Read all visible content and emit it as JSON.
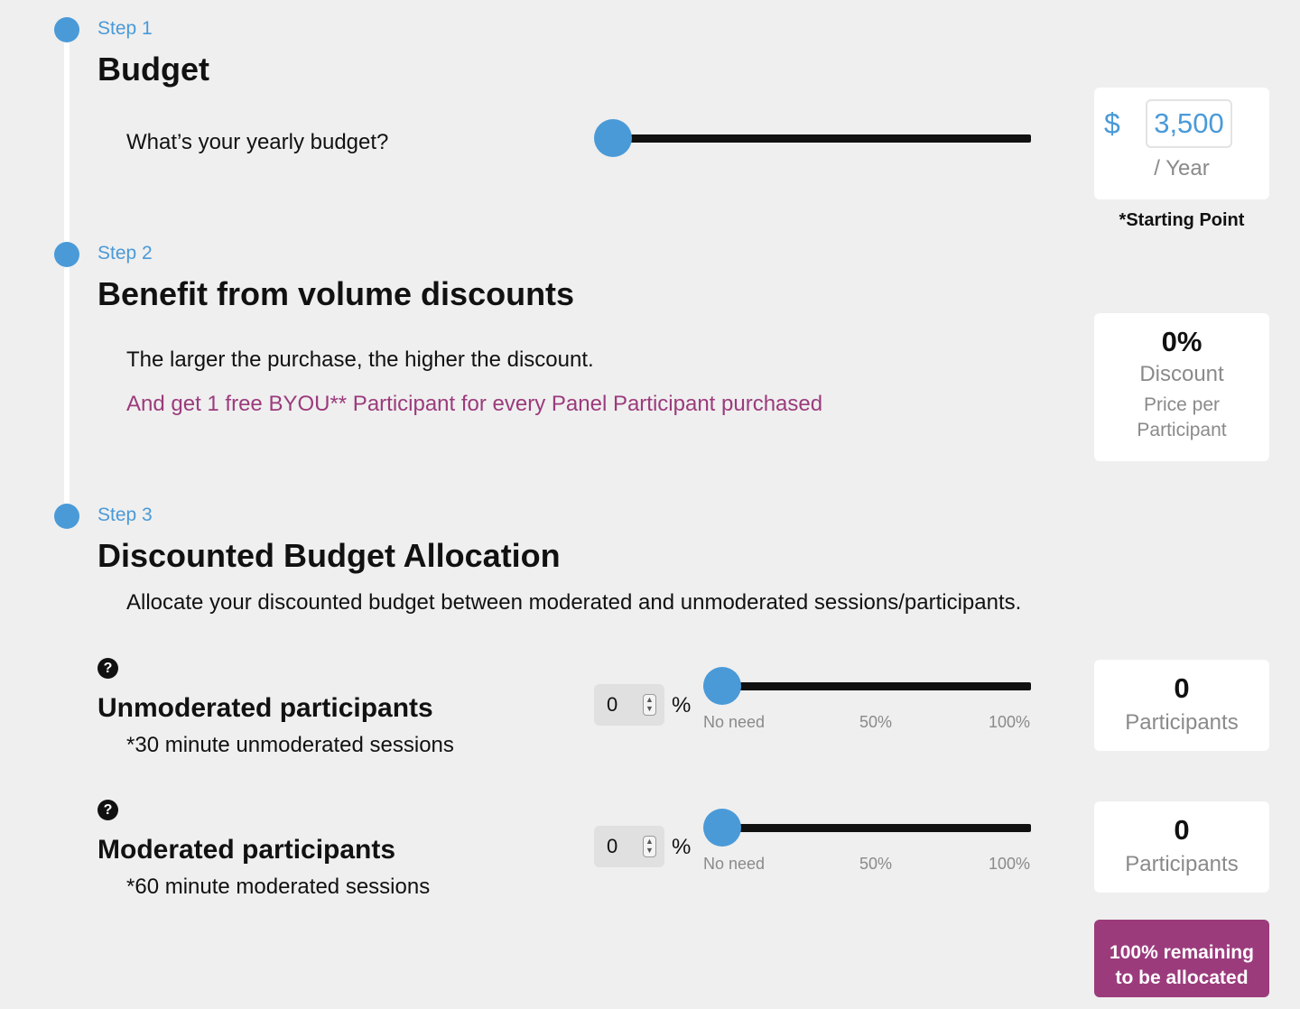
{
  "step1": {
    "label": "Step 1",
    "title": "Budget",
    "question": "What’s your yearly budget?",
    "slider_value": 0,
    "currency_symbol": "$",
    "budget_value": "3,500",
    "per_label": "/ Year",
    "note": "*Starting Point"
  },
  "step2": {
    "label": "Step 2",
    "title": "Benefit from volume discounts",
    "line1": "The larger the purchase, the higher the discount.",
    "line2": "And get 1 free BYOU** Participant for every Panel Participant purchased",
    "discount_value": "0%",
    "discount_label": "Discount",
    "price_label_1": "Price per",
    "price_label_2": "Participant"
  },
  "step3": {
    "label": "Step 3",
    "title": "Discounted Budget Allocation",
    "description": "Allocate your discounted budget between moderated and unmoderated sessions/participants.",
    "scale_labels": [
      "No need",
      "50%",
      "100%"
    ],
    "percent_sign": "%",
    "unmoderated": {
      "help_glyph": "?",
      "title": "Unmoderated participants",
      "subtitle": "*30 minute unmoderated sessions",
      "input_value": "0",
      "slider_percent": 0,
      "count": "0",
      "count_label": "Participants"
    },
    "moderated": {
      "help_glyph": "?",
      "title": "Moderated participants",
      "subtitle": "*60 minute moderated sessions",
      "input_value": "0",
      "slider_percent": 0,
      "count": "0",
      "count_label": "Participants"
    },
    "remaining_line1": "100% remaining",
    "remaining_line2": "to be allocated"
  },
  "colors": {
    "accent_blue": "#4a9ad8",
    "accent_magenta": "#9b3b7c",
    "background": "#efefef"
  }
}
